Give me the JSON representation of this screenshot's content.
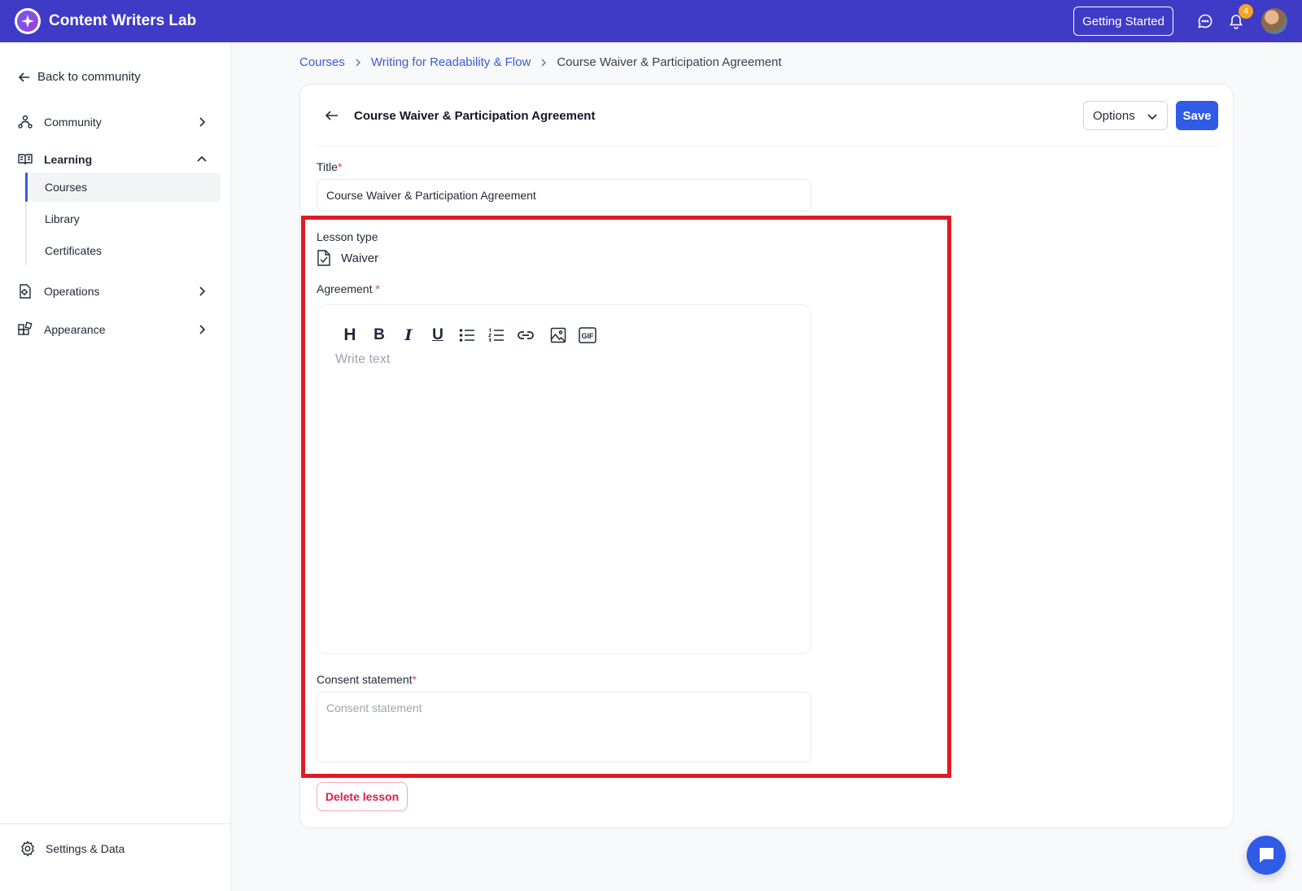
{
  "app": {
    "name": "Content Writers Lab",
    "getting_started": "Getting Started",
    "notification_count": "4"
  },
  "sidebar": {
    "back_label": "Back to community",
    "items": [
      {
        "label": "Community",
        "icon": "community-icon"
      },
      {
        "label": "Learning",
        "icon": "book-icon"
      },
      {
        "label": "Operations",
        "icon": "operations-icon"
      },
      {
        "label": "Appearance",
        "icon": "appearance-icon"
      }
    ],
    "learning_sub": [
      {
        "label": "Courses",
        "active": true
      },
      {
        "label": "Library"
      },
      {
        "label": "Certificates"
      }
    ],
    "settings_label": "Settings & Data"
  },
  "breadcrumb": {
    "items": [
      "Courses",
      "Writing for Readability & Flow"
    ],
    "current": "Course Waiver & Participation Agreement"
  },
  "card": {
    "title": "Course Waiver & Participation Agreement",
    "options_label": "Options",
    "save_label": "Save"
  },
  "form": {
    "title_label": "Title",
    "title_required": "*",
    "title_value": "Course Waiver & Participation Agreement",
    "lesson_type_label": "Lesson type",
    "lesson_type_value": "Waiver",
    "agreement_label": "Agreement ",
    "agreement_required": "*",
    "agreement_placeholder": "Write text",
    "toolbar": [
      "H",
      "B",
      "I",
      "U",
      "bullet-list-icon",
      "numbered-list-icon",
      "link-icon",
      "image-icon",
      "gif-icon"
    ],
    "gif_text": "GIF",
    "consent_label": "Consent statement",
    "consent_required": "*",
    "consent_placeholder": "Consent statement",
    "delete_label": "Delete lesson"
  },
  "colors": {
    "topbar": "#3f3bc7",
    "primary": "#2f5be7",
    "highlight": "#e01b24",
    "danger": "#e11d48"
  }
}
